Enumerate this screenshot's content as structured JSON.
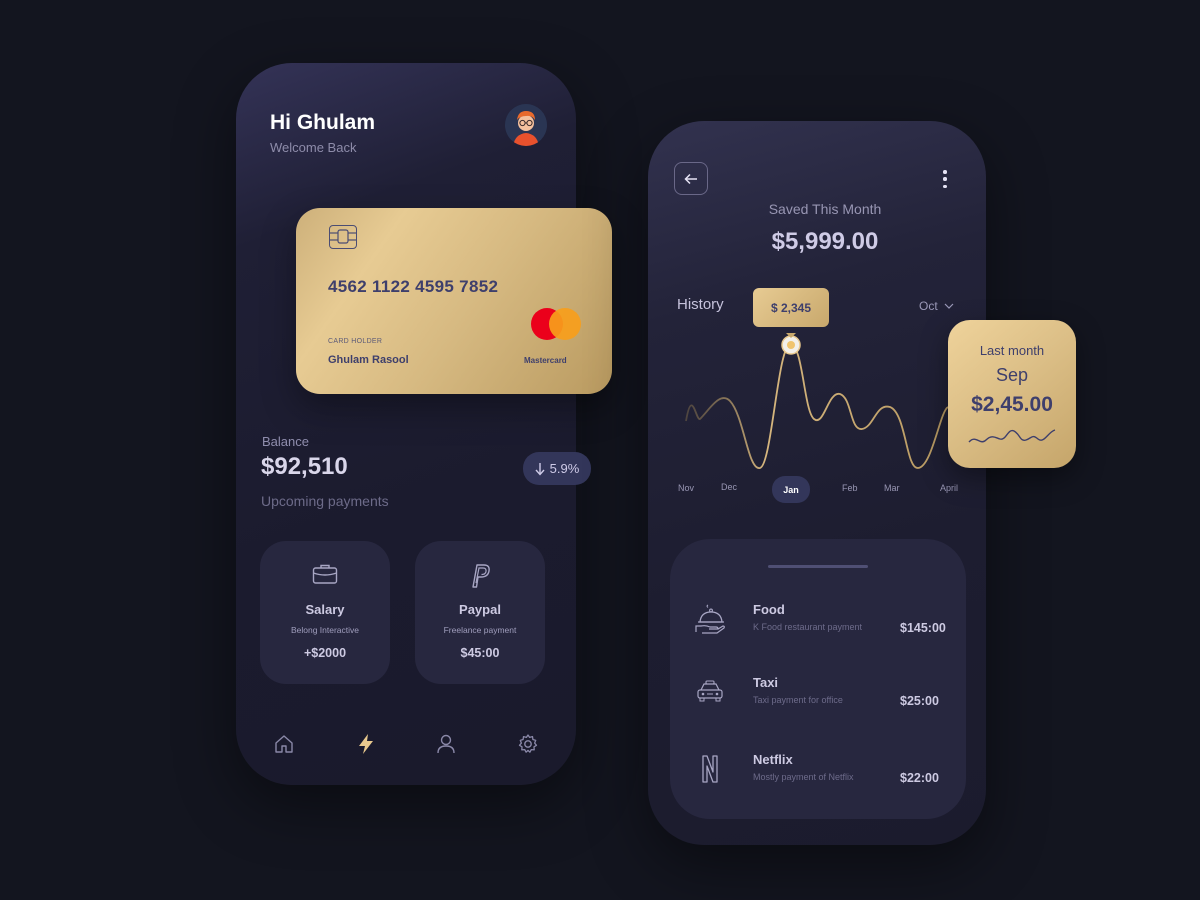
{
  "home": {
    "greeting": "Hi Ghulam",
    "welcome": "Welcome Back",
    "avatar_icon": "user-avatar"
  },
  "card": {
    "number": "4562 1122 4595 7852",
    "holder_label": "CARD HOLDER",
    "holder_name": "Ghulam Rasool",
    "network": "Mastercard"
  },
  "balance": {
    "label": "Balance",
    "value": "$92,510",
    "change": "5.9%",
    "change_direction_icon": "arrow-down-icon"
  },
  "upcoming": {
    "label": "Upcoming payments",
    "items": [
      {
        "title": "Salary",
        "subtitle": "Belong Interactive",
        "amount": "+$2000",
        "icon": "briefcase-icon"
      },
      {
        "title": "Paypal",
        "subtitle": "Freelance payment",
        "amount": "$45:00",
        "icon": "paypal-icon"
      }
    ]
  },
  "bottom_nav": {
    "items": [
      "home-icon",
      "lightning-icon",
      "profile-icon",
      "settings-icon"
    ],
    "active": "lightning-icon"
  },
  "savings": {
    "label": "Saved This Month",
    "value": "$5,999.00",
    "history_label": "History",
    "selected_point": "$ 2,345",
    "month_filter": "Oct",
    "x_labels": [
      "Nov",
      "Dec",
      "Jan",
      "Feb",
      "Mar",
      "April"
    ],
    "active_x": "Jan"
  },
  "last_month": {
    "label": "Last month",
    "month": "Sep",
    "value": "$2,45.00"
  },
  "transactions": [
    {
      "title": "Food",
      "subtitle": "K Food restaurant payment",
      "amount": "$145:00",
      "icon": "food-icon"
    },
    {
      "title": "Taxi",
      "subtitle": "Taxi payment for office",
      "amount": "$25:00",
      "icon": "taxi-icon"
    },
    {
      "title": "Netflix",
      "subtitle": "Mostly payment of Netflix",
      "amount": "$22:00",
      "icon": "netflix-icon"
    }
  ],
  "colors": {
    "background": "#13151f",
    "gold": "#dcbf87",
    "navy_text": "#3e3f6c",
    "tile": "#27273f"
  }
}
